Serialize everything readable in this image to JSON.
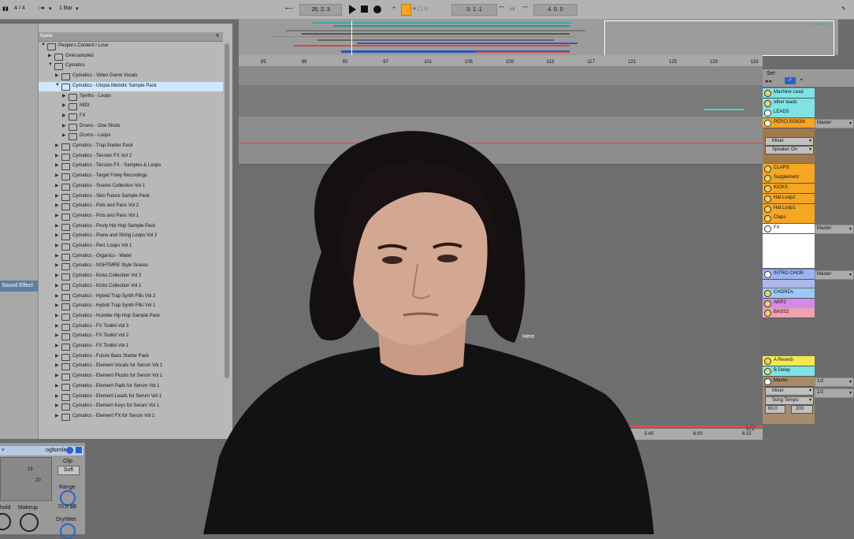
{
  "transport": {
    "time_signature": "4 / 4",
    "quantize": "1 Bar",
    "position": "26. 2. 3",
    "loop_start": "3. 1. 1",
    "loop_length": "4. 0. 0"
  },
  "browser": {
    "column_header": "Name",
    "side_selected_label": "Sound Effect",
    "items": [
      {
        "label": "People's Content I Love",
        "depth": 0,
        "open": true
      },
      {
        "label": "Oversampled",
        "depth": 1,
        "open": false
      },
      {
        "label": "Cymatics",
        "depth": 1,
        "open": true
      },
      {
        "label": "Cymatics - Video Game Vocals",
        "depth": 2,
        "open": false
      },
      {
        "label": "Cymatics - Utopia Melodic Sample Pack",
        "depth": 2,
        "open": true,
        "selected": true
      },
      {
        "label": "Synths - Loops",
        "depth": 3,
        "open": false
      },
      {
        "label": "MIDI",
        "depth": 3,
        "open": false
      },
      {
        "label": "FX",
        "depth": 3,
        "open": false
      },
      {
        "label": "Drums - One Shots",
        "depth": 3,
        "open": false
      },
      {
        "label": "Drums - Loops",
        "depth": 3,
        "open": false
      },
      {
        "label": "Cymatics - Trap Starter Pack",
        "depth": 2,
        "open": false
      },
      {
        "label": "Cymatics - Tension FX Vol 2",
        "depth": 2,
        "open": false
      },
      {
        "label": "Cymatics - Tension FX - Samples & Loops",
        "depth": 2,
        "open": false
      },
      {
        "label": "Cymatics - Target Foley Recordings",
        "depth": 2,
        "open": false
      },
      {
        "label": "Cymatics - Snares Collection Vol 1",
        "depth": 2,
        "open": false
      },
      {
        "label": "Cymatics - Skin Future Sample Pack",
        "depth": 2,
        "open": false
      },
      {
        "label": "Cymatics - Pots and Pans Vol 2",
        "depth": 2,
        "open": false
      },
      {
        "label": "Cymatics - Pots and Pans Vol 1",
        "depth": 2,
        "open": false
      },
      {
        "label": "Cymatics - Posty Hip Hop Sample Pack",
        "depth": 2,
        "open": false
      },
      {
        "label": "Cymatics - Piano and String Loops Vol 2",
        "depth": 2,
        "open": false
      },
      {
        "label": "Cymatics - Perc Loops Vol 1",
        "depth": 2,
        "open": false
      },
      {
        "label": "Cymatics - Organics - Water",
        "depth": 2,
        "open": false
      },
      {
        "label": "Cymatics - NGHTMRE Style Snares",
        "depth": 2,
        "open": false
      },
      {
        "label": "Cymatics - Kicks Collection Vol 2",
        "depth": 2,
        "open": false
      },
      {
        "label": "Cymatics - Kicks Collection Vol 1",
        "depth": 2,
        "open": false
      },
      {
        "label": "Cymatics - Hybrid Trap Synth Fills Vol 2",
        "depth": 2,
        "open": false
      },
      {
        "label": "Cymatics - Hybrid Trap Synth Fills Vol 1",
        "depth": 2,
        "open": false
      },
      {
        "label": "Cymatics - Humble Hip Hop Sample Pack",
        "depth": 2,
        "open": false
      },
      {
        "label": "Cymatics - FX Toolkit Vol 3",
        "depth": 2,
        "open": false
      },
      {
        "label": "Cymatics - FX Toolkit Vol 2",
        "depth": 2,
        "open": false
      },
      {
        "label": "Cymatics - FX Toolkit Vol 1",
        "depth": 2,
        "open": false
      },
      {
        "label": "Cymatics - Future Bass Starter Pack",
        "depth": 2,
        "open": false
      },
      {
        "label": "Cymatics - Element Vocals for Serum Vol 1",
        "depth": 2,
        "open": false
      },
      {
        "label": "Cymatics - Element Plucks for Serum Vol 1",
        "depth": 2,
        "open": false
      },
      {
        "label": "Cymatics - Element Pads for Serum Vol 1",
        "depth": 2,
        "open": false
      },
      {
        "label": "Cymatics - Element Leads for Serum Vol 1",
        "depth": 2,
        "open": false
      },
      {
        "label": "Cymatics - Element Keys for Serum Vol 1",
        "depth": 2,
        "open": false
      },
      {
        "label": "Cymatics - Element FX for Serum Vol 1",
        "depth": 2,
        "open": false
      }
    ]
  },
  "ruler": {
    "bars": [
      "85",
      "89",
      "93",
      "97",
      "101",
      "105",
      "109",
      "113",
      "117",
      "121",
      "125",
      "129",
      "133"
    ],
    "times": [
      "5:45",
      "6:00",
      "6:15"
    ],
    "page": "1/2"
  },
  "set": {
    "label": "Set",
    "tracks": [
      {
        "name": "Machine Lead",
        "color": "#7fe3e6",
        "kind": "track"
      },
      {
        "name": "other leads",
        "color": "#7fe3e6",
        "kind": "track"
      },
      {
        "name": "LEADS",
        "color": "#7fe3e6",
        "kind": "group"
      },
      {
        "name": "PERCUSSION",
        "color": "#f5a623",
        "kind": "group",
        "route": "Master"
      },
      {
        "name": "CLAPS",
        "color": "#f5a623",
        "kind": "track"
      },
      {
        "name": "Supplement",
        "color": "#f5a623",
        "kind": "track"
      },
      {
        "name": "KICKS",
        "color": "#f5a623",
        "kind": "track"
      },
      {
        "name": "Hat Loop2",
        "color": "#f5a623",
        "kind": "track"
      },
      {
        "name": "Hat Loop1",
        "color": "#f5a623",
        "kind": "track"
      },
      {
        "name": "Claps",
        "color": "#f5a623",
        "kind": "track"
      },
      {
        "name": "FX",
        "color": "#ffffff",
        "kind": "group",
        "route": "Master"
      },
      {
        "name": "INTRO CHOR",
        "color": "#9bb4f5",
        "kind": "group",
        "route": "Master"
      },
      {
        "name": "CHORDs",
        "color": "#9bc9f5",
        "kind": "track"
      },
      {
        "name": "ARP2",
        "color": "#d28be8",
        "kind": "track"
      },
      {
        "name": "BASS2",
        "color": "#f0a0b0",
        "kind": "track"
      },
      {
        "name": "A Reverb",
        "color": "#f3e94f",
        "kind": "return"
      },
      {
        "name": "B Delay",
        "color": "#7fe3e6",
        "kind": "return"
      },
      {
        "name": "Master",
        "color": "#a58b6a",
        "kind": "master"
      }
    ],
    "percussion_selectors": [
      "Mixer",
      "Speaker On"
    ],
    "master_selectors": [
      "Mixer",
      "Song Tempo"
    ],
    "master_routes": [
      "1/2",
      "1/2"
    ],
    "tempo_min": "60.0",
    "tempo_max": "200"
  },
  "device": {
    "title": "ogltomle",
    "clip_label": "Clip",
    "clip_mode": "Soft",
    "range_label": "Range",
    "range_value": "70.0 dB",
    "dry_wet_label": "Dry/Wet",
    "hold_label": "hold",
    "makeup_label": "Makeup",
    "scale_15": "15",
    "scale_20": "20"
  },
  "overlay": {
    "here_text": "Here"
  }
}
